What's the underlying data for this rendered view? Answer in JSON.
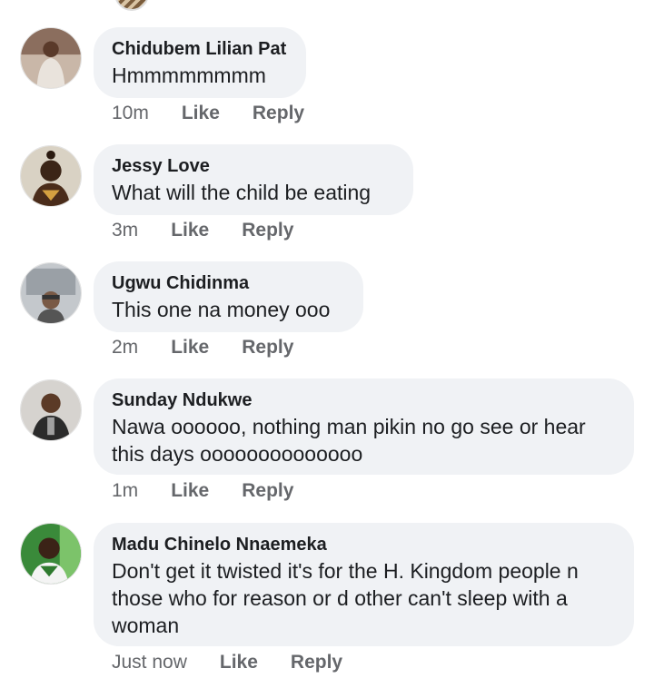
{
  "comments": [
    {
      "author": "Chidubem Lilian Pat",
      "text": "Hmmmmmmmm",
      "time": "10m",
      "like": "Like",
      "reply": "Reply"
    },
    {
      "author": "Jessy Love",
      "text": "What  will the child be eating",
      "time": "3m",
      "like": "Like",
      "reply": "Reply"
    },
    {
      "author": "Ugwu Chidinma",
      "text": "This one na money ooo",
      "time": "2m",
      "like": "Like",
      "reply": "Reply"
    },
    {
      "author": "Sunday Ndukwe",
      "text": "Nawa oooooo, nothing man pikin no go see or hear this days oooooooooooooo",
      "time": "1m",
      "like": "Like",
      "reply": "Reply"
    },
    {
      "author": "Madu Chinelo Nnaemeka",
      "text": "Don't get it twisted it's for the H. Kingdom people n those who for reason or d other can't sleep with a woman",
      "time": "Just now",
      "like": "Like",
      "reply": "Reply"
    }
  ],
  "colors": {
    "bubble": "#f0f2f5",
    "meta": "#65676b",
    "text": "#1c1e21"
  }
}
